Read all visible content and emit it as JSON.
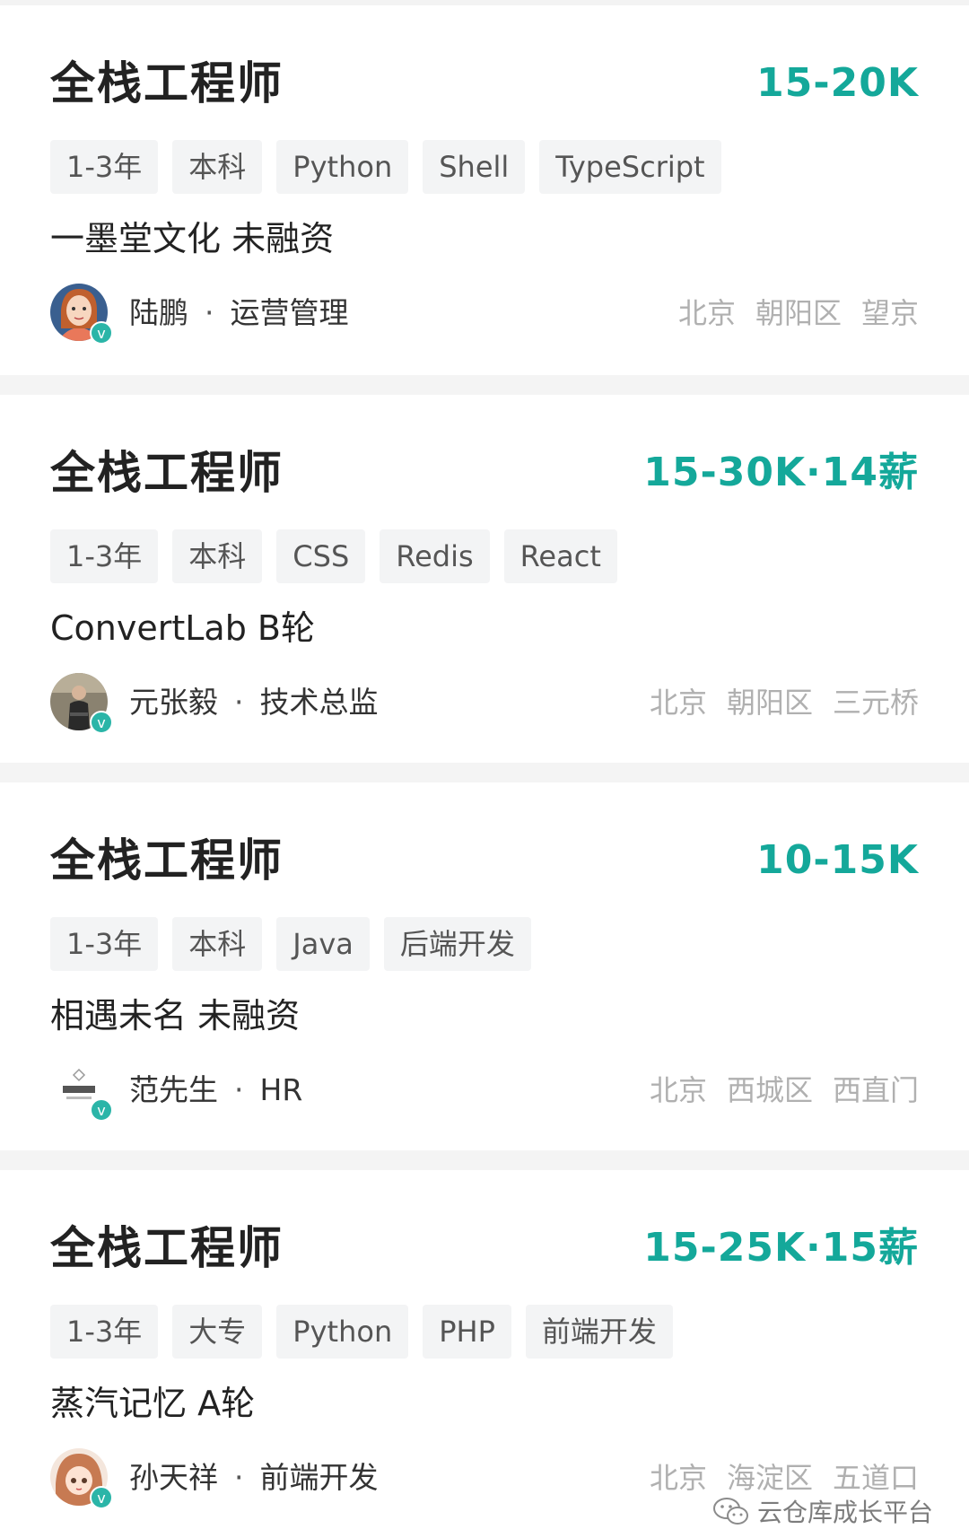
{
  "jobs": [
    {
      "title": "全栈工程师",
      "salary": "15-20K",
      "tags": [
        "1-3年",
        "本科",
        "Python",
        "Shell",
        "TypeScript"
      ],
      "company": "一墨堂文化 未融资",
      "recruiter_name": "陆鹏",
      "recruiter_role": "运营管理",
      "location": [
        "北京",
        "朝阳区",
        "望京"
      ],
      "avatar_icon": "cartoon-woman-avatar"
    },
    {
      "title": "全栈工程师",
      "salary": "15-30K·14薪",
      "tags": [
        "1-3年",
        "本科",
        "CSS",
        "Redis",
        "React"
      ],
      "company": "ConvertLab B轮",
      "recruiter_name": "元张毅",
      "recruiter_role": "技术总监",
      "location": [
        "北京",
        "朝阳区",
        "三元桥"
      ],
      "avatar_icon": "photo-person-avatar"
    },
    {
      "title": "全栈工程师",
      "salary": "10-15K",
      "tags": [
        "1-3年",
        "本科",
        "Java",
        "后端开发"
      ],
      "company": "相遇未名 未融资",
      "recruiter_name": "范先生",
      "recruiter_role": "HR",
      "location": [
        "北京",
        "西城区",
        "西直门"
      ],
      "avatar_icon": "company-logo-avatar"
    },
    {
      "title": "全栈工程师",
      "salary": "15-25K·15薪",
      "tags": [
        "1-3年",
        "大专",
        "Python",
        "PHP",
        "前端开发"
      ],
      "company": "蒸汽记忆 A轮",
      "recruiter_name": "孙天祥",
      "recruiter_role": "前端开发",
      "location": [
        "北京",
        "海淀区",
        "五道口"
      ],
      "avatar_icon": "anime-girl-avatar"
    }
  ],
  "verify_badge": "v",
  "separator": "·",
  "watermark": "云仓库成长平台",
  "colors": {
    "salary": "#14a89a",
    "badge": "#2bb5a8",
    "tag_bg": "#f3f4f5",
    "divider": "#f4f4f4"
  }
}
